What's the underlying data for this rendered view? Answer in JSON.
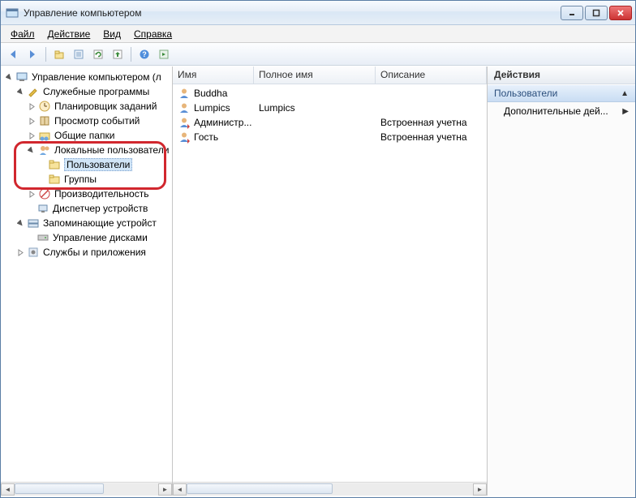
{
  "window": {
    "title": "Управление компьютером"
  },
  "menu": {
    "file": "Файл",
    "action": "Действие",
    "view": "Вид",
    "help": "Справка"
  },
  "toolbar_icons": [
    "back",
    "forward",
    "up",
    "show-hide",
    "refresh",
    "export",
    "help",
    "play"
  ],
  "tree": {
    "root": "Управление компьютером (л",
    "utilities": "Служебные программы",
    "scheduler": "Планировщик заданий",
    "event_viewer": "Просмотр событий",
    "shared_folders": "Общие папки",
    "local_users": "Локальные пользователи",
    "users": "Пользователи",
    "groups": "Группы",
    "performance": "Производительность",
    "device_mgr": "Диспетчер устройств",
    "storage": "Запоминающие устройст",
    "disk_mgmt": "Управление дисками",
    "services": "Службы и приложения"
  },
  "list": {
    "columns": {
      "name": "Имя",
      "fullname": "Полное имя",
      "description": "Описание"
    },
    "rows": [
      {
        "name": "Buddha",
        "fullname": "",
        "description": ""
      },
      {
        "name": "Lumpics",
        "fullname": "Lumpics",
        "description": ""
      },
      {
        "name": "Администр...",
        "fullname": "",
        "description": "Встроенная учетна"
      },
      {
        "name": "Гость",
        "fullname": "",
        "description": "Встроенная учетна"
      }
    ]
  },
  "actions": {
    "header": "Действия",
    "group": "Пользователи",
    "more": "Дополнительные дей..."
  }
}
